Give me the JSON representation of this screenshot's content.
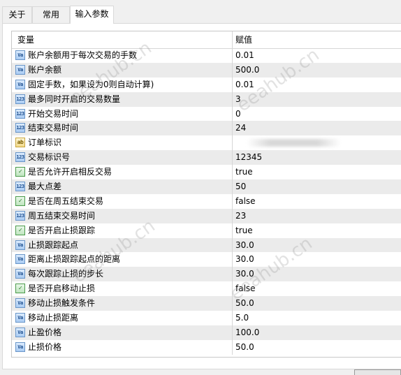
{
  "tabs": [
    {
      "label": "关于"
    },
    {
      "label": "常用"
    },
    {
      "label": "输入参数"
    }
  ],
  "table": {
    "header_name": "变量",
    "header_value": "赋值",
    "rows": [
      {
        "icon": "number-icon",
        "type": "Va",
        "name": "账户余额用于每次交易的手数",
        "value": "0.01"
      },
      {
        "icon": "number-icon",
        "type": "Va",
        "name": "账户余额",
        "value": "500.0"
      },
      {
        "icon": "number-icon",
        "type": "Va",
        "name": "固定手数，如果设为0则自动计算)",
        "value": "0.01"
      },
      {
        "icon": "integer-icon",
        "type": "123",
        "name": "最多同时开启的交易数量",
        "value": "3"
      },
      {
        "icon": "integer-icon",
        "type": "123",
        "name": "开始交易时间",
        "value": "0"
      },
      {
        "icon": "integer-icon",
        "type": "123",
        "name": "结束交易时间",
        "value": "24"
      },
      {
        "icon": "string-icon",
        "type": "ab",
        "name": "订单标识",
        "value": ""
      },
      {
        "icon": "integer-icon",
        "type": "123",
        "name": "交易标识号",
        "value": "12345"
      },
      {
        "icon": "boolean-icon",
        "type": "✓",
        "name": "是否允许开启相反交易",
        "value": "true"
      },
      {
        "icon": "integer-icon",
        "type": "123",
        "name": "最大点差",
        "value": "50"
      },
      {
        "icon": "boolean-icon",
        "type": "✓",
        "name": "是否在周五结束交易",
        "value": "false"
      },
      {
        "icon": "integer-icon",
        "type": "123",
        "name": "周五结束交易时间",
        "value": "23"
      },
      {
        "icon": "boolean-icon",
        "type": "✓",
        "name": "是否开启止损跟踪",
        "value": "true"
      },
      {
        "icon": "number-icon",
        "type": "Va",
        "name": "止损跟踪起点",
        "value": "30.0"
      },
      {
        "icon": "number-icon",
        "type": "Va",
        "name": "距离止损跟踪起点的距离",
        "value": "30.0"
      },
      {
        "icon": "number-icon",
        "type": "Va",
        "name": "每次跟踪止损的步长",
        "value": "30.0"
      },
      {
        "icon": "boolean-icon",
        "type": "✓",
        "name": "是否开启移动止损",
        "value": "false"
      },
      {
        "icon": "number-icon",
        "type": "Va",
        "name": "移动止损触发条件",
        "value": "50.0"
      },
      {
        "icon": "number-icon",
        "type": "Va",
        "name": "移动止损距离",
        "value": "5.0"
      },
      {
        "icon": "number-icon",
        "type": "Va",
        "name": "止盈价格",
        "value": "100.0"
      },
      {
        "icon": "number-icon",
        "type": "Va",
        "name": "止损价格",
        "value": "50.0"
      }
    ]
  },
  "watermark": "eeahub.cn"
}
